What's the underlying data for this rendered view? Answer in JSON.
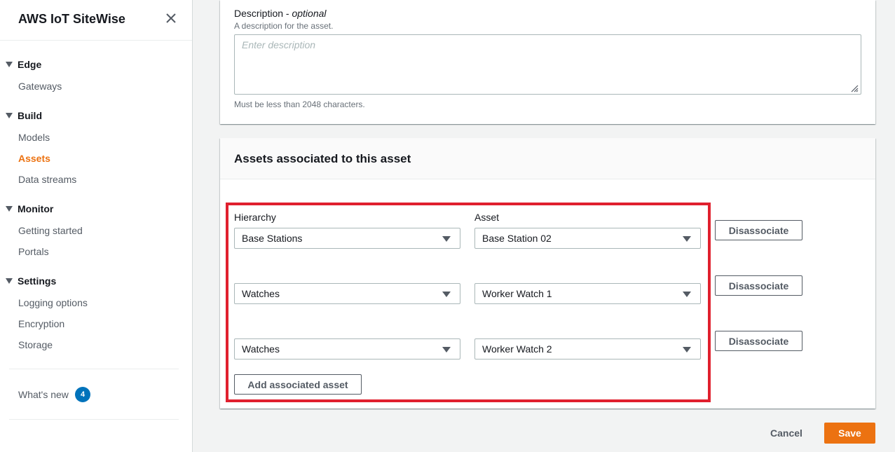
{
  "sidebar": {
    "title": "AWS IoT SiteWise",
    "sections": [
      {
        "label": "Edge",
        "items": [
          {
            "label": "Gateways"
          }
        ]
      },
      {
        "label": "Build",
        "items": [
          {
            "label": "Models"
          },
          {
            "label": "Assets",
            "active": true
          },
          {
            "label": "Data streams"
          }
        ]
      },
      {
        "label": "Monitor",
        "items": [
          {
            "label": "Getting started"
          },
          {
            "label": "Portals"
          }
        ]
      },
      {
        "label": "Settings",
        "items": [
          {
            "label": "Logging options"
          },
          {
            "label": "Encryption"
          },
          {
            "label": "Storage"
          }
        ]
      }
    ],
    "whats_new": {
      "label": "What's new",
      "count": "4"
    }
  },
  "description": {
    "label": "Description - ",
    "optional": "optional",
    "hint": "A description for the asset.",
    "placeholder": "Enter description",
    "constraint": "Must be less than 2048 characters."
  },
  "associations": {
    "title": "Assets associated to this asset",
    "hierarchy_label": "Hierarchy",
    "asset_label": "Asset",
    "rows": [
      {
        "hierarchy": "Base Stations",
        "asset": "Base Station 02",
        "action": "Disassociate"
      },
      {
        "hierarchy": "Watches",
        "asset": "Worker Watch 1",
        "action": "Disassociate"
      },
      {
        "hierarchy": "Watches",
        "asset": "Worker Watch 2",
        "action": "Disassociate"
      }
    ],
    "add_label": "Add associated asset"
  },
  "footer": {
    "cancel": "Cancel",
    "save": "Save"
  },
  "colors": {
    "accent": "#ec7211",
    "badge": "#0073bb",
    "highlight": "#e0202e"
  }
}
